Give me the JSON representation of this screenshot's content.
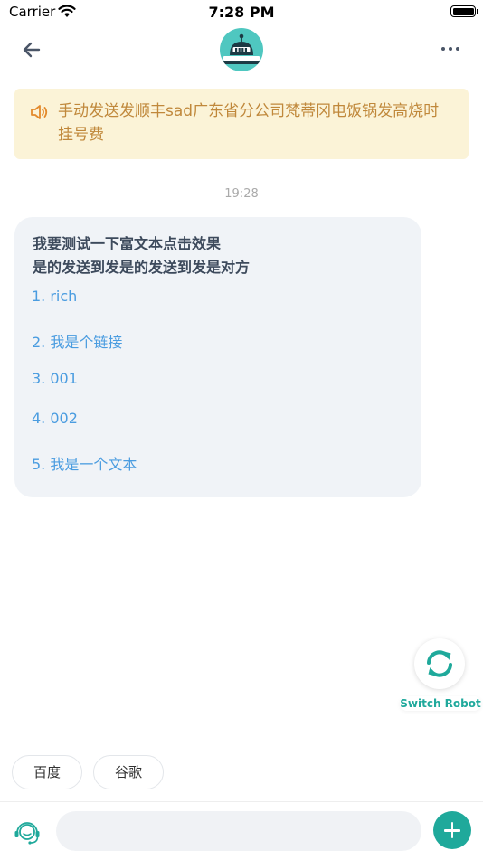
{
  "status_bar": {
    "carrier": "Carrier",
    "time": "7:28 PM"
  },
  "nav": {
    "back_icon": "arrow-left-icon",
    "avatar_icon": "robot-icon",
    "more_icon": "more-dots-icon"
  },
  "notice": {
    "icon": "speaker-icon",
    "text": "手动发送发顺丰sad广东省分公司梵蒂冈电饭锅发高烧时挂号费",
    "color": "#c0883b",
    "background": "#fbf3d7"
  },
  "chat": {
    "timestamp": "19:28",
    "message": {
      "title_line1": "我要测试一下富文本点击效果",
      "title_line2": "是的发送到发是的发送到发是对方",
      "links": [
        "1. rich",
        "2. 我是个链接",
        "3. 001",
        "4. 002",
        "5. 我是一个文本"
      ]
    }
  },
  "switch_robot": {
    "label": "Switch Robot",
    "icon": "refresh-icon"
  },
  "quick_replies": [
    "百度",
    "谷歌"
  ],
  "input": {
    "placeholder": "",
    "agent_icon": "headset-agent-icon",
    "plus_icon": "plus-icon"
  },
  "colors": {
    "accent": "#1fa99b",
    "link": "#4a9ce0",
    "bubble": "#f0f3f7"
  }
}
